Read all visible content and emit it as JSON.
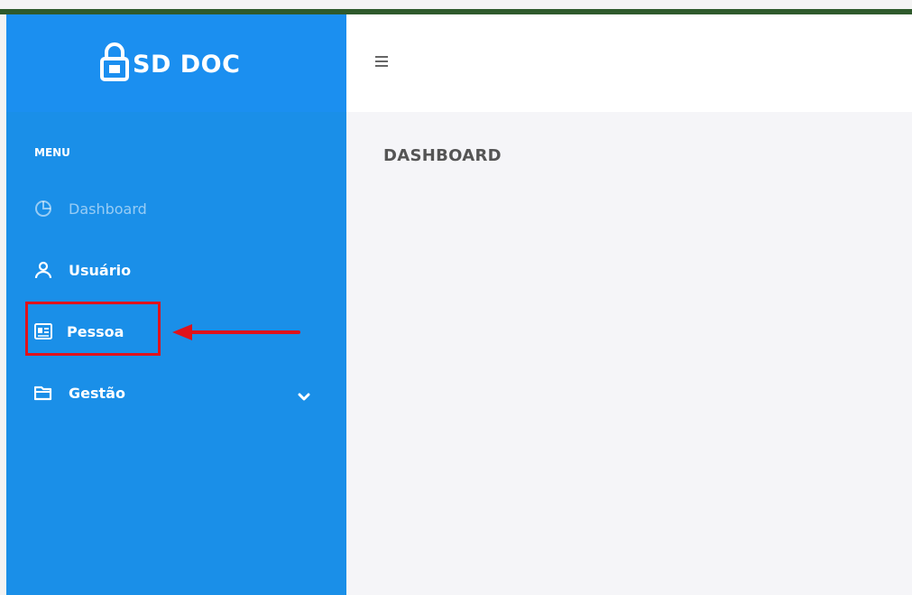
{
  "brand": {
    "name": "SD DOC",
    "icon": "lock-icon"
  },
  "sidebar": {
    "menu_label": "MENU",
    "items": [
      {
        "label": "Dashboard",
        "icon": "pie-chart-icon",
        "state": "dim"
      },
      {
        "label": "Usuário",
        "icon": "user-icon"
      },
      {
        "label": "Pessoa",
        "icon": "id-card-icon",
        "highlighted": true
      },
      {
        "label": "Gestão",
        "icon": "folder-icon",
        "has_submenu": true
      }
    ]
  },
  "header": {
    "menu_toggle_icon": "hamburger-icon"
  },
  "main": {
    "page_title": "DASHBOARD"
  },
  "colors": {
    "sidebar": "#1a8fe8",
    "highlight": "#e0121b",
    "content_bg": "#f5f5f8",
    "top_line": "#2f5a2c"
  }
}
